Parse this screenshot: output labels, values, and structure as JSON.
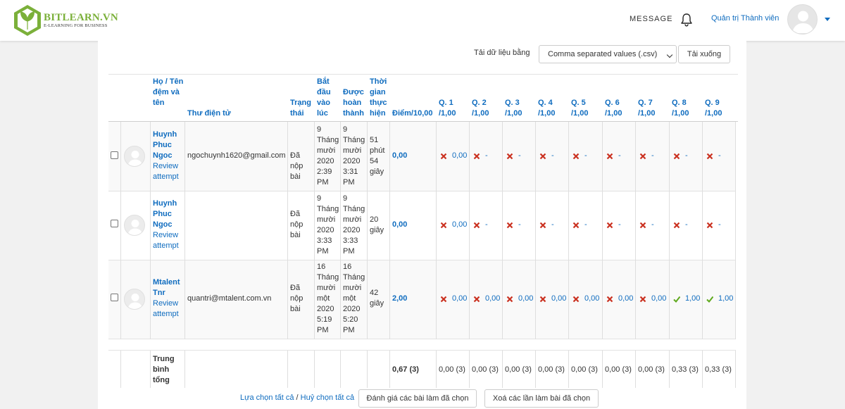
{
  "brand": {
    "name": "BITLEARN.VN",
    "tagline": "E-LEARNING FOR BUSINESS"
  },
  "nav": {
    "message": "MESSAGE",
    "user_link": "Quản trị Thành viên"
  },
  "download": {
    "label": "Tải dữ liệu bằng",
    "format": "Comma separated values (.csv)",
    "button": "Tải xuống"
  },
  "columns": {
    "name": "Họ / Tên đệm và tên",
    "email": "Thư điện tử",
    "state": "Trạng thái",
    "started": "Bắt đầu vào lúc",
    "completed": "Được hoàn thành",
    "duration": "Thời gian thực hiện",
    "grade": "Điểm/10,00",
    "questions": [
      "Q. 1 /1,00",
      "Q. 2 /1,00",
      "Q. 3 /1,00",
      "Q. 4 /1,00",
      "Q. 5 /1,00",
      "Q. 6 /1,00",
      "Q. 7 /1,00",
      "Q. 8 /1,00",
      "Q. 9 /1,00"
    ]
  },
  "rows": [
    {
      "name": "Huynh Phuc Ngoc",
      "review": "Review attempt",
      "email": "ngochuynh1620@gmail.com",
      "state": "Đã nộp bài",
      "started": "9 Tháng mười 2020 2:39 PM",
      "completed": "9 Tháng mười 2020 3:31 PM",
      "duration": "51 phút 54 giây",
      "grade": "0,00",
      "answers": [
        {
          "mark": "x",
          "value": "0,00"
        },
        {
          "mark": "x",
          "value": "-"
        },
        {
          "mark": "x",
          "value": "-"
        },
        {
          "mark": "x",
          "value": "-"
        },
        {
          "mark": "x",
          "value": "-"
        },
        {
          "mark": "x",
          "value": "-"
        },
        {
          "mark": "x",
          "value": "-"
        },
        {
          "mark": "x",
          "value": "-"
        },
        {
          "mark": "x",
          "value": "-"
        }
      ]
    },
    {
      "name": "Huynh Phuc Ngoc",
      "review": "Review attempt",
      "email": "",
      "state": "Đã nộp bài",
      "started": "9 Tháng mười 2020 3:33 PM",
      "completed": "9 Tháng mười 2020 3:33 PM",
      "duration": "20 giây",
      "grade": "0,00",
      "answers": [
        {
          "mark": "x",
          "value": "0,00"
        },
        {
          "mark": "x",
          "value": "-"
        },
        {
          "mark": "x",
          "value": "-"
        },
        {
          "mark": "x",
          "value": "-"
        },
        {
          "mark": "x",
          "value": "-"
        },
        {
          "mark": "x",
          "value": "-"
        },
        {
          "mark": "x",
          "value": "-"
        },
        {
          "mark": "x",
          "value": "-"
        },
        {
          "mark": "x",
          "value": "-"
        }
      ]
    },
    {
      "name": "Mtalent Tnr",
      "review": "Review attempt",
      "email": "quantri@mtalent.com.vn",
      "state": "Đã nộp bài",
      "started": "16 Tháng mười một 2020 5:19 PM",
      "completed": "16 Tháng mười một 2020 5:20 PM",
      "duration": "42 giây",
      "grade": "2,00",
      "answers": [
        {
          "mark": "x",
          "value": "0,00"
        },
        {
          "mark": "x",
          "value": "0,00"
        },
        {
          "mark": "x",
          "value": "0,00"
        },
        {
          "mark": "x",
          "value": "0,00"
        },
        {
          "mark": "x",
          "value": "0,00"
        },
        {
          "mark": "x",
          "value": "0,00"
        },
        {
          "mark": "x",
          "value": "0,00"
        },
        {
          "mark": "check",
          "value": "1,00"
        },
        {
          "mark": "check",
          "value": "1,00"
        }
      ]
    }
  ],
  "average": {
    "label": "Trung bình tổng",
    "grade": "0,67 (3)",
    "questions": [
      "0,00 (3)",
      "0,00 (3)",
      "0,00 (3)",
      "0,00 (3)",
      "0,00 (3)",
      "0,00 (3)",
      "0,00 (3)",
      "0,33 (3)",
      "0,33 (3)"
    ]
  },
  "actions": {
    "select_all": "Lựa chọn tất cả",
    "separator": "/",
    "deselect_all": "Huỷ chọn tất cả",
    "regrade": "Đánh giá các bài làm đã chọn",
    "delete": "Xoá các lần làm bài đã chọn"
  },
  "colors": {
    "link": "#0f6cbf",
    "cross": "#ca3120",
    "check": "#5fa91d",
    "brand": "#7bb03a"
  }
}
